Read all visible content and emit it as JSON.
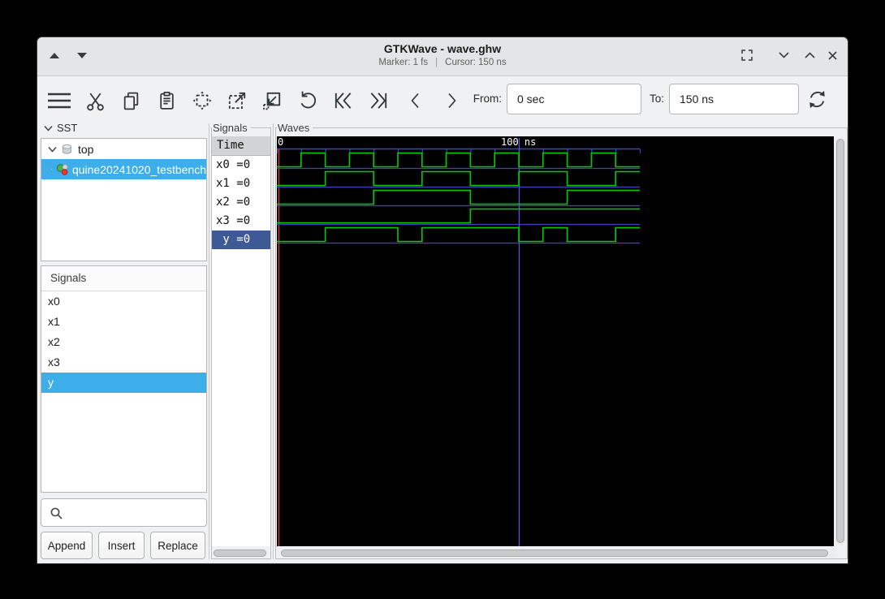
{
  "window": {
    "title": "GTKWave - wave.ghw",
    "marker_status": "Marker: 1 fs",
    "status_separator": "|",
    "cursor_status": "Cursor: 150 ns",
    "left_controls": [
      "up-arrow",
      "down-arrow"
    ],
    "right_controls": [
      "fullscreen",
      "minimize",
      "maximize",
      "close"
    ]
  },
  "toolbar": {
    "icon_names": [
      "menu",
      "cut",
      "copy",
      "paste",
      "zoom-fit",
      "zoom-in",
      "zoom-out",
      "undo",
      "skip-to-start",
      "skip-to-end",
      "previous",
      "next",
      "reload"
    ],
    "from_label": "From:",
    "from_value": "0 sec",
    "to_label": "To:",
    "to_value": "150 ns"
  },
  "sst": {
    "header": "SST",
    "tree": [
      {
        "label": "top",
        "expanded": true,
        "icon": "cylinder"
      },
      {
        "label": "quine20241020_testbench",
        "selected": true,
        "icon": "module"
      }
    ],
    "signals_header": "Signals",
    "signals": [
      "x0",
      "x1",
      "x2",
      "x3",
      "y"
    ],
    "selected_signal": "y",
    "search_placeholder": "",
    "buttons": {
      "append": "Append",
      "insert": "Insert",
      "replace": "Replace"
    }
  },
  "signals_panel": {
    "frame_label": "Signals",
    "time_header": "Time",
    "rows": [
      {
        "name": "x0",
        "value": "=0",
        "selected": false
      },
      {
        "name": "x1",
        "value": "=0",
        "selected": false
      },
      {
        "name": "x2",
        "value": "=0",
        "selected": false
      },
      {
        "name": "x3",
        "value": "=0",
        "selected": false
      },
      {
        "name": "y",
        "value": "=0",
        "selected": true
      }
    ]
  },
  "waves_panel": {
    "frame_label": "Waves"
  },
  "colors": {
    "accent_selection": "#3daee9",
    "unfocused_selection": "#3d5a96",
    "titlebar": "#e4e5e6",
    "window_bg": "#f0f1f2"
  },
  "chart_data": {
    "type": "digital-waveform",
    "time_unit": "ns",
    "xrange": [
      0,
      150
    ],
    "tick_interval": 10,
    "timeline_labels": [
      {
        "t": 0,
        "text": "0"
      },
      {
        "t": 100,
        "text": "100 ns"
      }
    ],
    "marker_caption": "Marker: 1 fs",
    "marker_time_ns": 0,
    "cursor_caption": "Cursor: 150 ns",
    "cursor_line_t": 100,
    "signals": [
      {
        "name": "x0",
        "initial": 0,
        "high_intervals": [
          [
            10,
            20
          ],
          [
            30,
            40
          ],
          [
            50,
            60
          ],
          [
            70,
            80
          ],
          [
            90,
            100
          ],
          [
            110,
            120
          ],
          [
            130,
            140
          ]
        ]
      },
      {
        "name": "x1",
        "initial": 0,
        "high_intervals": [
          [
            20,
            40
          ],
          [
            60,
            80
          ],
          [
            100,
            120
          ],
          [
            140,
            150
          ]
        ]
      },
      {
        "name": "x2",
        "initial": 0,
        "high_intervals": [
          [
            40,
            80
          ],
          [
            120,
            150
          ]
        ]
      },
      {
        "name": "x3",
        "initial": 0,
        "high_intervals": [
          [
            80,
            150
          ]
        ]
      },
      {
        "name": "y",
        "initial": 0,
        "high_intervals": [
          [
            20,
            50
          ],
          [
            60,
            100
          ],
          [
            110,
            120
          ],
          [
            140,
            150
          ]
        ]
      }
    ],
    "colors": {
      "wave": "#00cd00",
      "grid": "#4343bd",
      "cursor_line": "#5558dd",
      "marker_line": "#d04545",
      "background": "#000000",
      "label_text": "#ffffff"
    }
  }
}
